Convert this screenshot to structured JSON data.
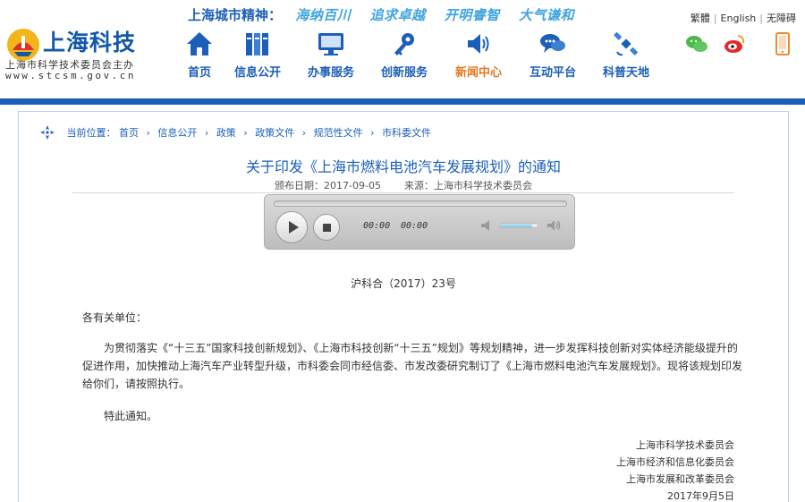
{
  "site": {
    "logo_name": "上海科技",
    "logo_sub": "上海市科学技术委员会主办",
    "logo_url": "www.stcsm.gov.cn"
  },
  "spirit": {
    "title": "上海城市精神：",
    "words": [
      "海纳百川",
      "追求卓越",
      "开明睿智",
      "大气谦和"
    ]
  },
  "nav": [
    {
      "label": "首页",
      "icon": "home-icon"
    },
    {
      "label": "信息公开",
      "icon": "binders-icon"
    },
    {
      "label": "办事服务",
      "icon": "monitor-icon"
    },
    {
      "label": "创新服务",
      "icon": "key-icon"
    },
    {
      "label": "新闻中心",
      "icon": "speaker-icon",
      "active": true
    },
    {
      "label": "互动平台",
      "icon": "chat-icon"
    },
    {
      "label": "科普天地",
      "icon": "satellite-icon"
    }
  ],
  "top_links": [
    "繁體",
    "English",
    "无障碍"
  ],
  "social": [
    "wechat-icon",
    "weibo-icon",
    "mobile-icon"
  ],
  "colors": {
    "primary": "#1c5fb8",
    "active": "#e6781e",
    "accent": "#3fa4e0"
  },
  "breadcrumb": {
    "label": "当前位置：",
    "items": [
      "首页",
      "信息公开",
      "政策",
      "政策文件",
      "规范性文件",
      "市科委文件"
    ]
  },
  "article": {
    "title": "关于印发《上海市燃料电池汽车发展规划》的通知",
    "date_label": "颁布日期：2017-09-05",
    "source_label": "来源：上海市科学技术委员会",
    "doc_no": "沪科合（2017）23号",
    "salutation": "各有关单位：",
    "paragraph": "为贯彻落实《“十三五”国家科技创新规划》、《上海市科技创新“十三五”规划》等规划精神，进一步发挥科技创新对实体经济能级提升的促进作用，加快推动上海汽车产业转型升级，市科委会同市经信委、市发改委研究制订了《上海市燃料电池汽车发展规划》。现将该规划印发给你们，请按照执行。",
    "closing": "特此通知。",
    "signatures": [
      "上海市科学技术委员会",
      "上海市经济和信息化委员会",
      "上海市发展和改革委员会",
      "2017年9月5日"
    ]
  },
  "player": {
    "current_time": "00:00",
    "duration": "00:00",
    "progress": 0,
    "volume": 0.85
  }
}
